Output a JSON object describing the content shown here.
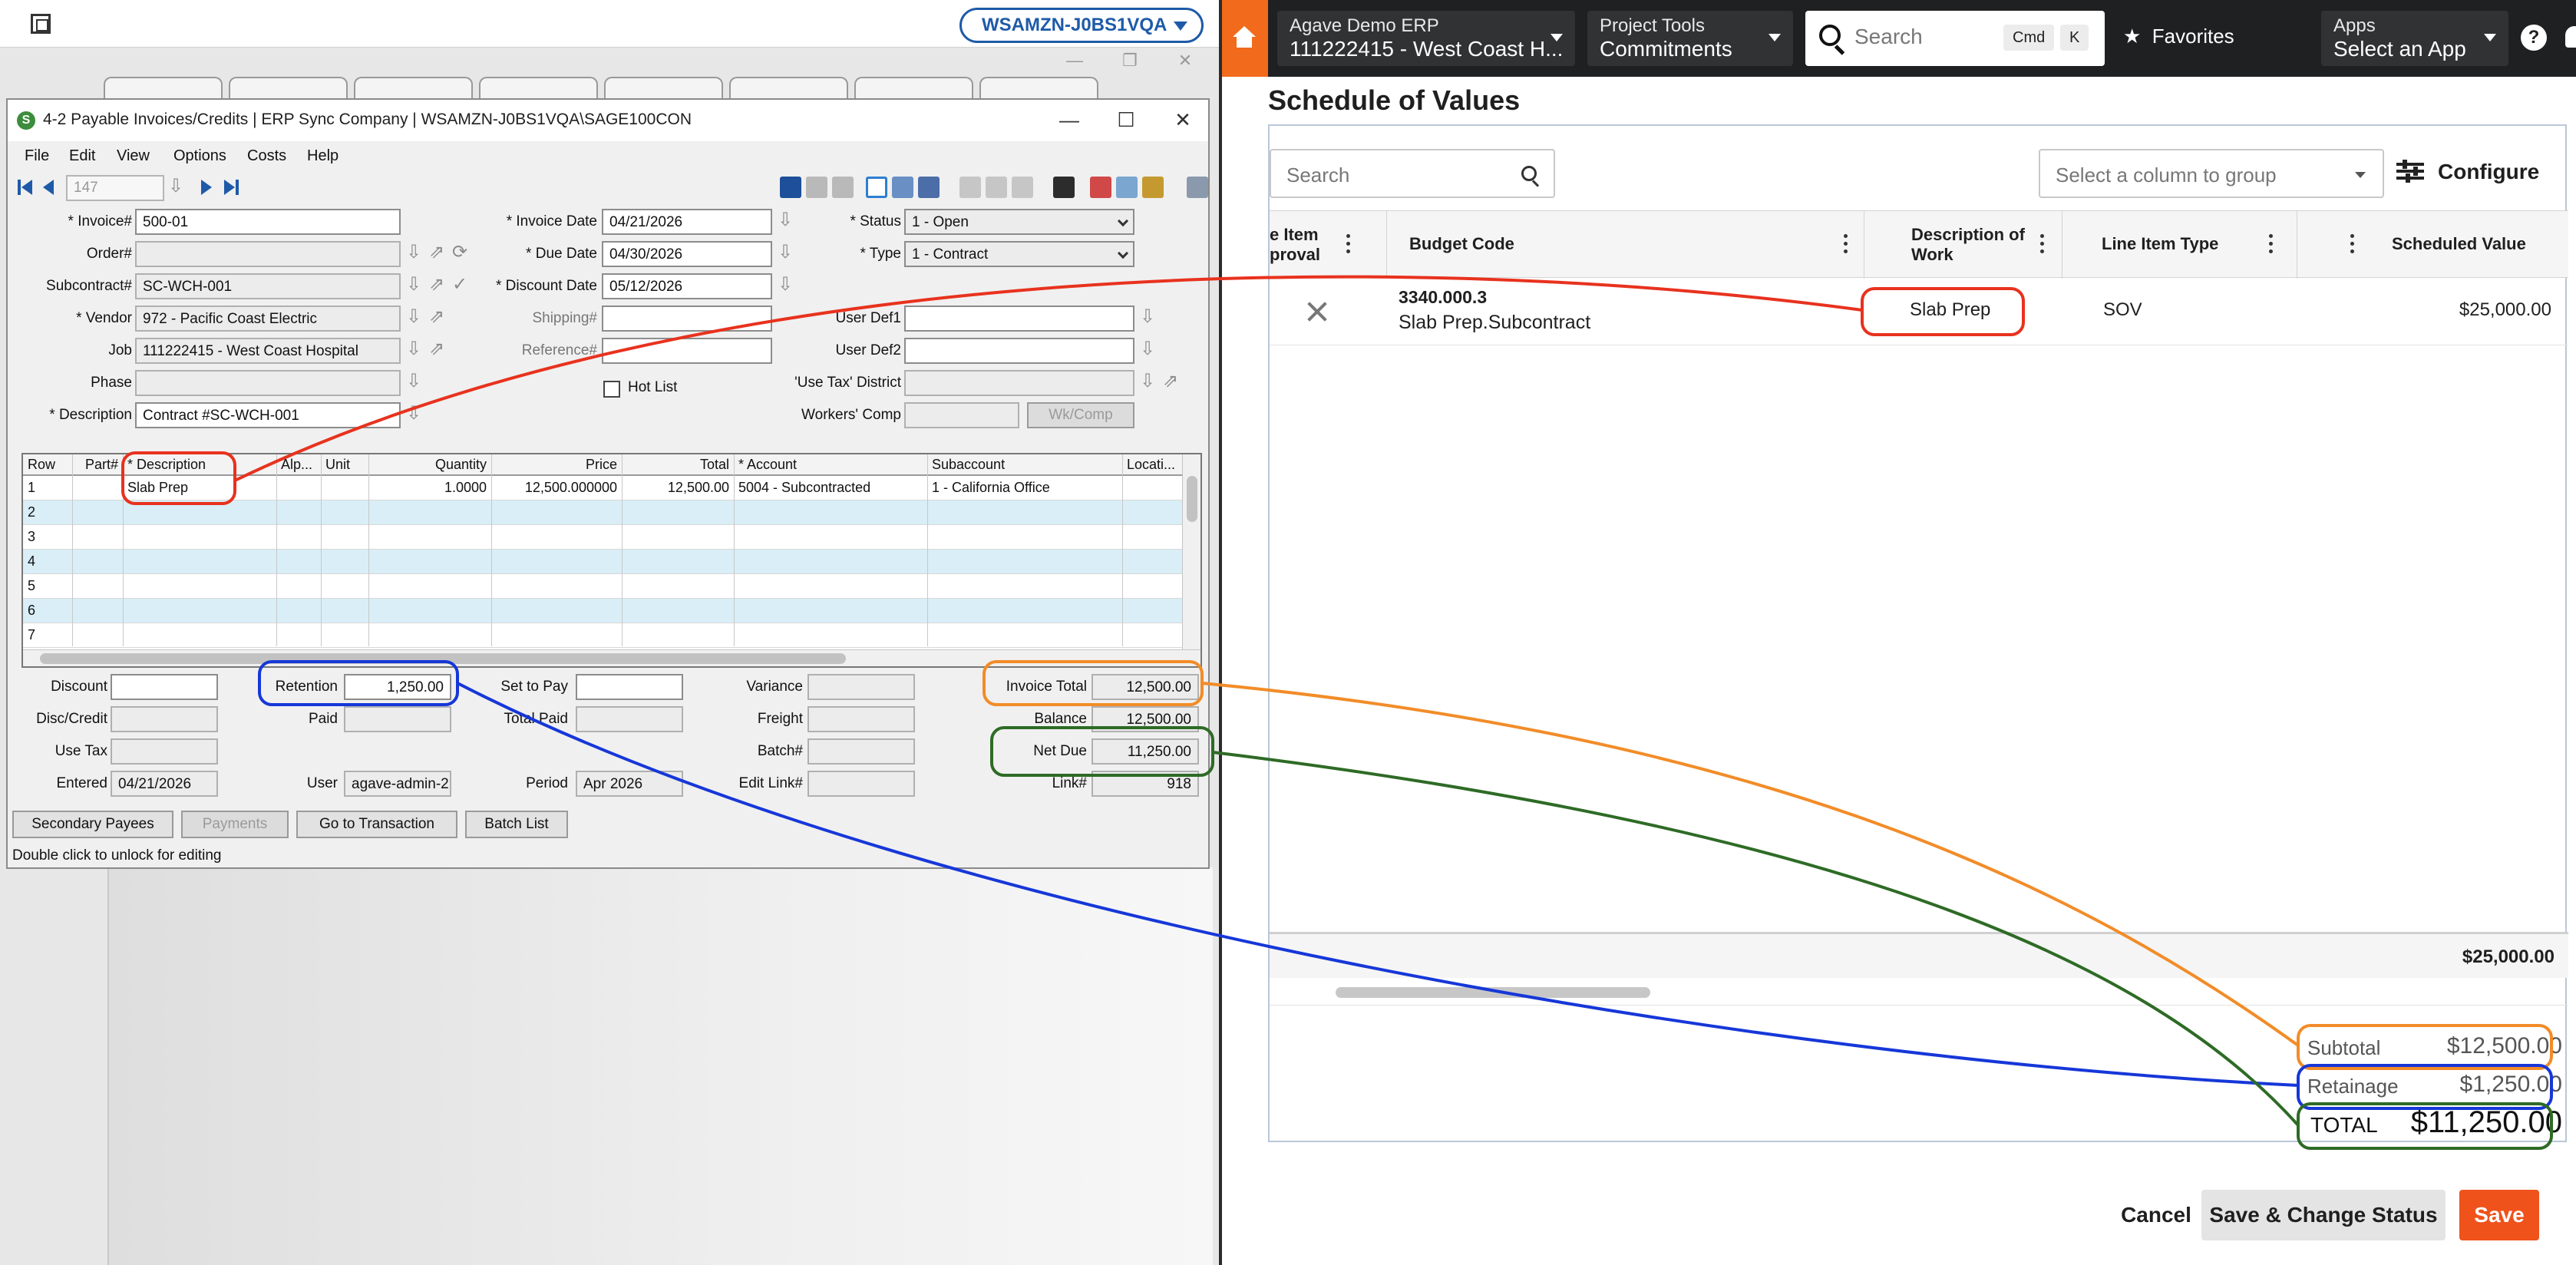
{
  "left": {
    "server_pill": "WSAMZN-J0BS1VQA",
    "window": {
      "title": "4-2 Payable Invoices/Credits  |  ERP Sync Company  |  WSAMZN-J0BS1VQA\\SAGE100CON",
      "menu": [
        "File",
        "Edit",
        "View",
        "Options",
        "Costs",
        "Help"
      ],
      "record_number": "147"
    },
    "form": {
      "invoice_label": "* Invoice#",
      "invoice_value": "500-01",
      "order_label": "Order#",
      "order_value": "",
      "subcontract_label": "Subcontract#",
      "subcontract_value": "SC-WCH-001",
      "vendor_label": "* Vendor",
      "vendor_value": "972 - Pacific Coast Electric",
      "job_label": "Job",
      "job_value": "111222415 - West Coast Hospital",
      "phase_label": "Phase",
      "phase_value": "",
      "description_label": "* Description",
      "description_value": "Contract #SC-WCH-001",
      "invoice_date_label": "* Invoice Date",
      "invoice_date_value": "04/21/2026",
      "due_date_label": "* Due Date",
      "due_date_value": "04/30/2026",
      "discount_date_label": "* Discount Date",
      "discount_date_value": "05/12/2026",
      "shipping_label": "Shipping#",
      "shipping_value": "",
      "reference_label": "Reference#",
      "reference_value": "",
      "hot_list_label": "Hot List",
      "status_label": "* Status",
      "status_value": "1 - Open",
      "type_label": "* Type",
      "type_value": "1 - Contract",
      "user_def1_label": "User Def1",
      "user_def1_value": "",
      "user_def2_label": "User Def2",
      "user_def2_value": "",
      "use_tax_district_label": "'Use Tax' District",
      "use_tax_district_value": "",
      "workers_comp_label": "Workers' Comp",
      "workers_comp_value": "",
      "wk_comp_button": "Wk/Comp"
    },
    "grid": {
      "columns": [
        "Row",
        "Part#",
        "* Description",
        "Alp...",
        "Unit",
        "Quantity",
        "Price",
        "Total",
        "* Account",
        "Subaccount",
        "Locati..."
      ],
      "rows": [
        {
          "row": "1",
          "part": "",
          "description": "Slab Prep",
          "alpha": "",
          "unit": "",
          "quantity": "1.0000",
          "price": "12,500.000000",
          "total": "12,500.00",
          "account": "5004 - Subcontracted",
          "subaccount": "1 - California Office",
          "location": ""
        },
        {
          "row": "2"
        },
        {
          "row": "3"
        },
        {
          "row": "4"
        },
        {
          "row": "5"
        },
        {
          "row": "6"
        },
        {
          "row": "7"
        }
      ]
    },
    "totals": {
      "discount_label": "Discount",
      "discount_value": "",
      "disc_credit_label": "Disc/Credit",
      "disc_credit_value": "",
      "use_tax_label": "Use Tax",
      "use_tax_value": "",
      "entered_label": "Entered",
      "entered_value": "04/21/2026",
      "retention_label": "Retention",
      "retention_value": "1,250.00",
      "paid_label": "Paid",
      "paid_value": "",
      "user_label": "User",
      "user_value": "agave-admin-2",
      "set_to_pay_label": "Set to Pay",
      "set_to_pay_value": "",
      "total_paid_label": "Total Paid",
      "total_paid_value": "",
      "period_label": "Period",
      "period_value": "Apr 2026",
      "variance_label": "Variance",
      "variance_value": "",
      "freight_label": "Freight",
      "freight_value": "",
      "batch_label": "Batch#",
      "batch_value": "",
      "edit_link_label": "Edit Link#",
      "edit_link_value": "",
      "invoice_total_label": "Invoice Total",
      "invoice_total_value": "12,500.00",
      "balance_label": "Balance",
      "balance_value": "12,500.00",
      "net_due_label": "Net Due",
      "net_due_value": "11,250.00",
      "link_label": "Link#",
      "link_value": "918"
    },
    "buttons": {
      "secondary_payees": "Secondary Payees",
      "payments": "Payments",
      "go_to_transaction": "Go to Transaction",
      "batch_list": "Batch List"
    },
    "status_text": "Double click to unlock for editing"
  },
  "right": {
    "header": {
      "company_small": "Agave Demo ERP",
      "company_big": "111222415 - West Coast H...",
      "tool_small": "Project Tools",
      "tool_big": "Commitments",
      "search_placeholder": "Search",
      "kbd_cmd": "Cmd",
      "kbd_k": "K",
      "favorites": "Favorites",
      "apps_small": "Apps",
      "apps_big": "Select an App"
    },
    "title": "Schedule of Values",
    "search_placeholder": "Search",
    "group_placeholder": "Select a column to group",
    "configure": "Configure",
    "columns": {
      "approval_line1": "e Item",
      "approval_line2": "proval",
      "budget_code": "Budget Code",
      "description_line1": "Description of",
      "description_line2": "Work",
      "line_item_type": "Line Item Type",
      "scheduled_value": "Scheduled Value"
    },
    "row": {
      "budget_code_line1": "3340.000.3",
      "budget_code_line2": "Slab Prep.Subcontract",
      "description": "Slab Prep",
      "line_item_type": "SOV",
      "scheduled_value": "$25,000.00"
    },
    "footer_total": "$25,000.00",
    "summary": {
      "subtotal_label": "Subtotal",
      "subtotal_value": "$12,500.00",
      "retainage_label": "Retainage",
      "retainage_value": "$1,250.00",
      "total_label": "TOTAL",
      "total_value": "$11,250.00"
    },
    "buttons": {
      "cancel": "Cancel",
      "save_change_status": "Save & Change Status",
      "save": "Save"
    }
  },
  "annotation_colors": {
    "description": "#e8321e",
    "invoice_total": "#f28c28",
    "retention": "#1637d8",
    "net_due": "#2e6b26"
  }
}
